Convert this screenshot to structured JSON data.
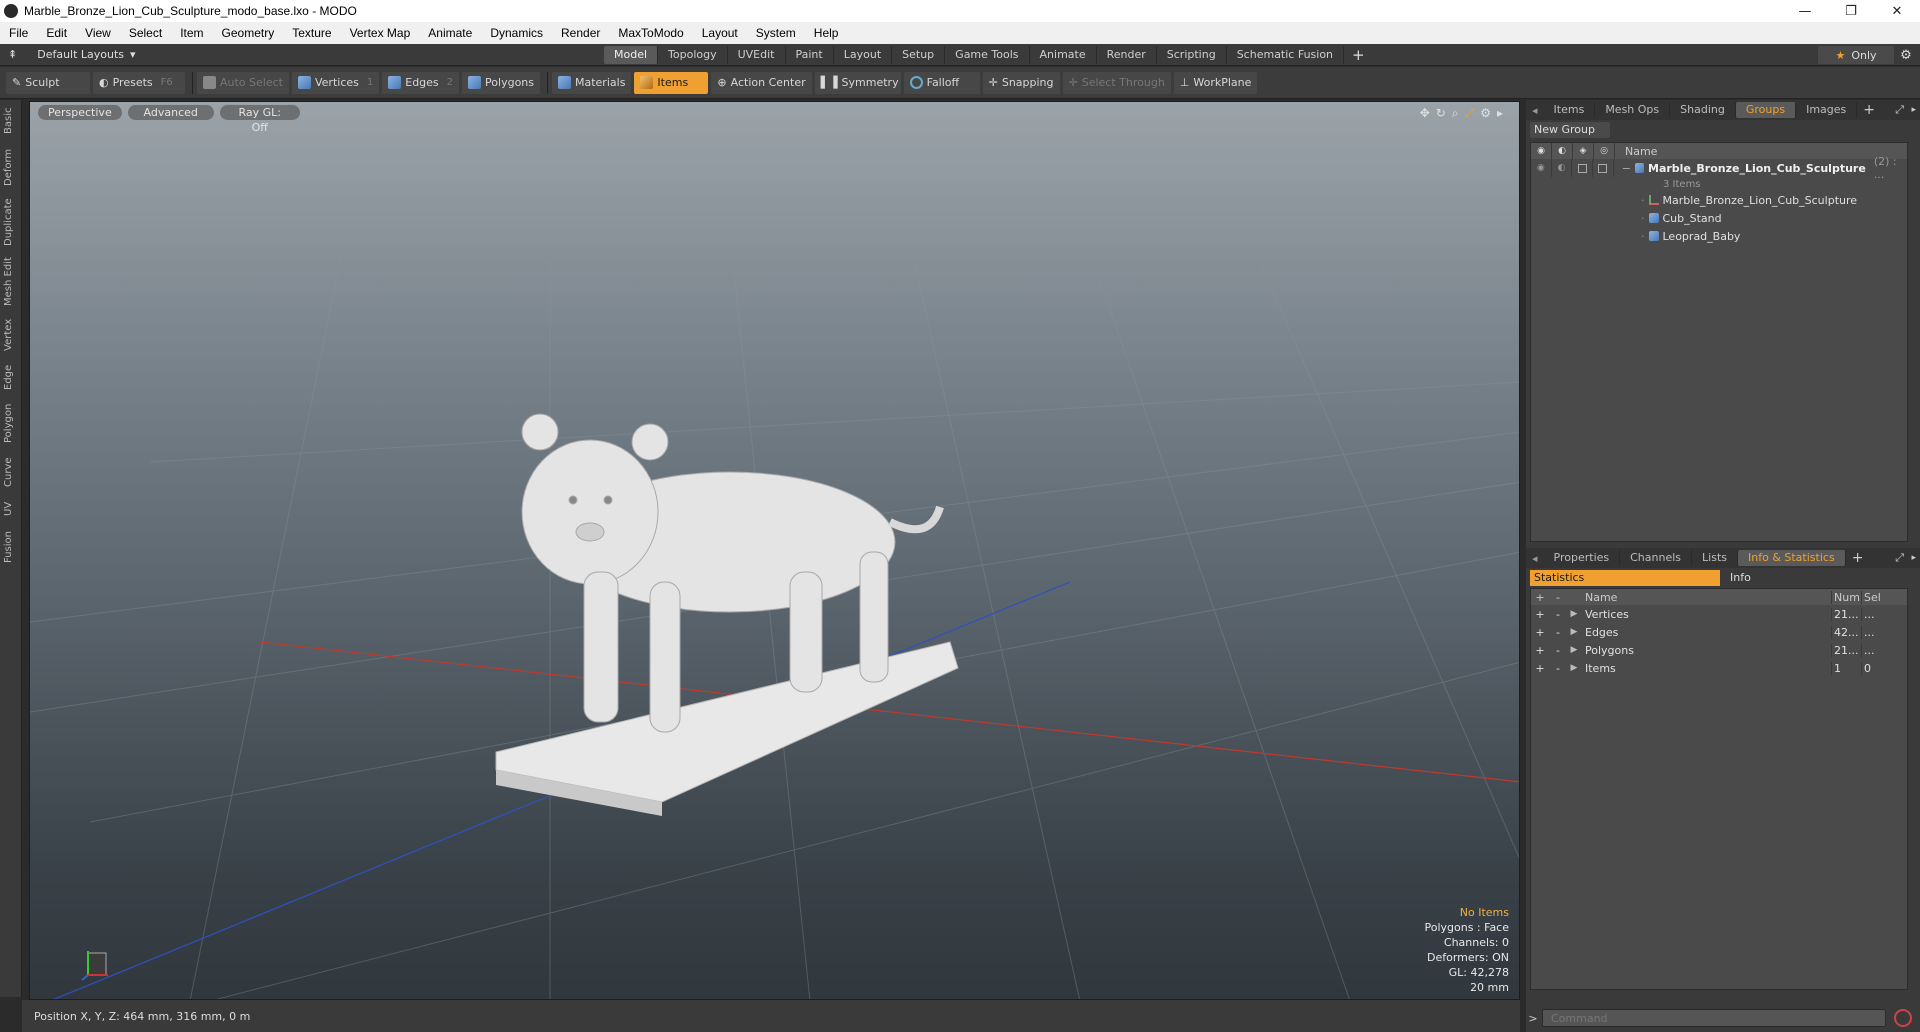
{
  "window": {
    "title": "Marble_Bronze_Lion_Cub_Sculpture_modo_base.lxo - MODO",
    "minimize": "—",
    "maximize": "❐",
    "close": "✕"
  },
  "menu": [
    "File",
    "Edit",
    "View",
    "Select",
    "Item",
    "Geometry",
    "Texture",
    "Vertex Map",
    "Animate",
    "Dynamics",
    "Render",
    "MaxToModo",
    "Layout",
    "System",
    "Help"
  ],
  "layoutbar": {
    "layouts_label": "Default Layouts",
    "mode_tabs": [
      "Model",
      "Topology",
      "UVEdit",
      "Paint",
      "Layout",
      "Setup",
      "Game Tools",
      "Animate",
      "Render",
      "Scripting",
      "Schematic Fusion"
    ],
    "active_tab": "Model",
    "only_label": "Only",
    "plus": "+"
  },
  "toolbar": {
    "sculpt": "Sculpt",
    "presets": "Presets",
    "presets_key": "F6",
    "auto_select": "Auto Select",
    "vertices": "Vertices",
    "vertices_num": "1",
    "edges": "Edges",
    "edges_num": "2",
    "polygons": "Polygons",
    "materials": "Materials",
    "items": "Items",
    "action_center": "Action Center",
    "symmetry": "Symmetry",
    "falloff": "Falloff",
    "snapping": "Snapping",
    "select_through": "Select Through",
    "workplane": "WorkPlane"
  },
  "left_tabs": [
    "Basic",
    "Deform",
    "Duplicate",
    "Mesh Edit",
    "Vertex",
    "Edge",
    "Polygon",
    "Curve",
    "UV",
    "Fusion"
  ],
  "viewport": {
    "perspective": "Perspective",
    "advanced": "Advanced",
    "raygl": "Ray GL: Off",
    "info": {
      "no_items": "No Items",
      "polygons": "Polygons : Face",
      "channels": "Channels: 0",
      "deformers": "Deformers: ON",
      "gl": "GL: 42,278",
      "scale": "20 mm"
    }
  },
  "status": {
    "position": "Position X, Y, Z:  464 mm, 316 mm, 0 m"
  },
  "right_top": {
    "tabs": [
      "Items",
      "Mesh Ops",
      "Shading",
      "Groups",
      "Images"
    ],
    "active_tab": "Groups",
    "new_group": "New Group",
    "name_header": "Name",
    "group": {
      "name": "Marble_Bronze_Lion_Cub_Sculpture",
      "count": "(2) : ...",
      "sub": "3 Items",
      "children": [
        "Marble_Bronze_Lion_Cub_Sculpture",
        "Cub_Stand",
        "Leoprad_Baby"
      ]
    }
  },
  "right_bottom": {
    "tabs": [
      "Properties",
      "Channels",
      "Lists",
      "Info & Statistics"
    ],
    "active_tab": "Info & Statistics",
    "sub_tabs": [
      "Statistics",
      "Info"
    ],
    "headers": {
      "plus": "+",
      "minus": "-",
      "name": "Name",
      "num": "Num",
      "sel": "Sel"
    },
    "rows": [
      {
        "name": "Vertices",
        "num": "21...",
        "sel": "..."
      },
      {
        "name": "Edges",
        "num": "42...",
        "sel": "..."
      },
      {
        "name": "Polygons",
        "num": "21...",
        "sel": "..."
      },
      {
        "name": "Items",
        "num": "1",
        "sel": "0"
      }
    ]
  },
  "command": {
    "placeholder": "Command",
    "caret": ">"
  },
  "colors": {
    "accent": "#f0a030",
    "axis_x": "#c0392b",
    "axis_z": "#3050c0"
  }
}
